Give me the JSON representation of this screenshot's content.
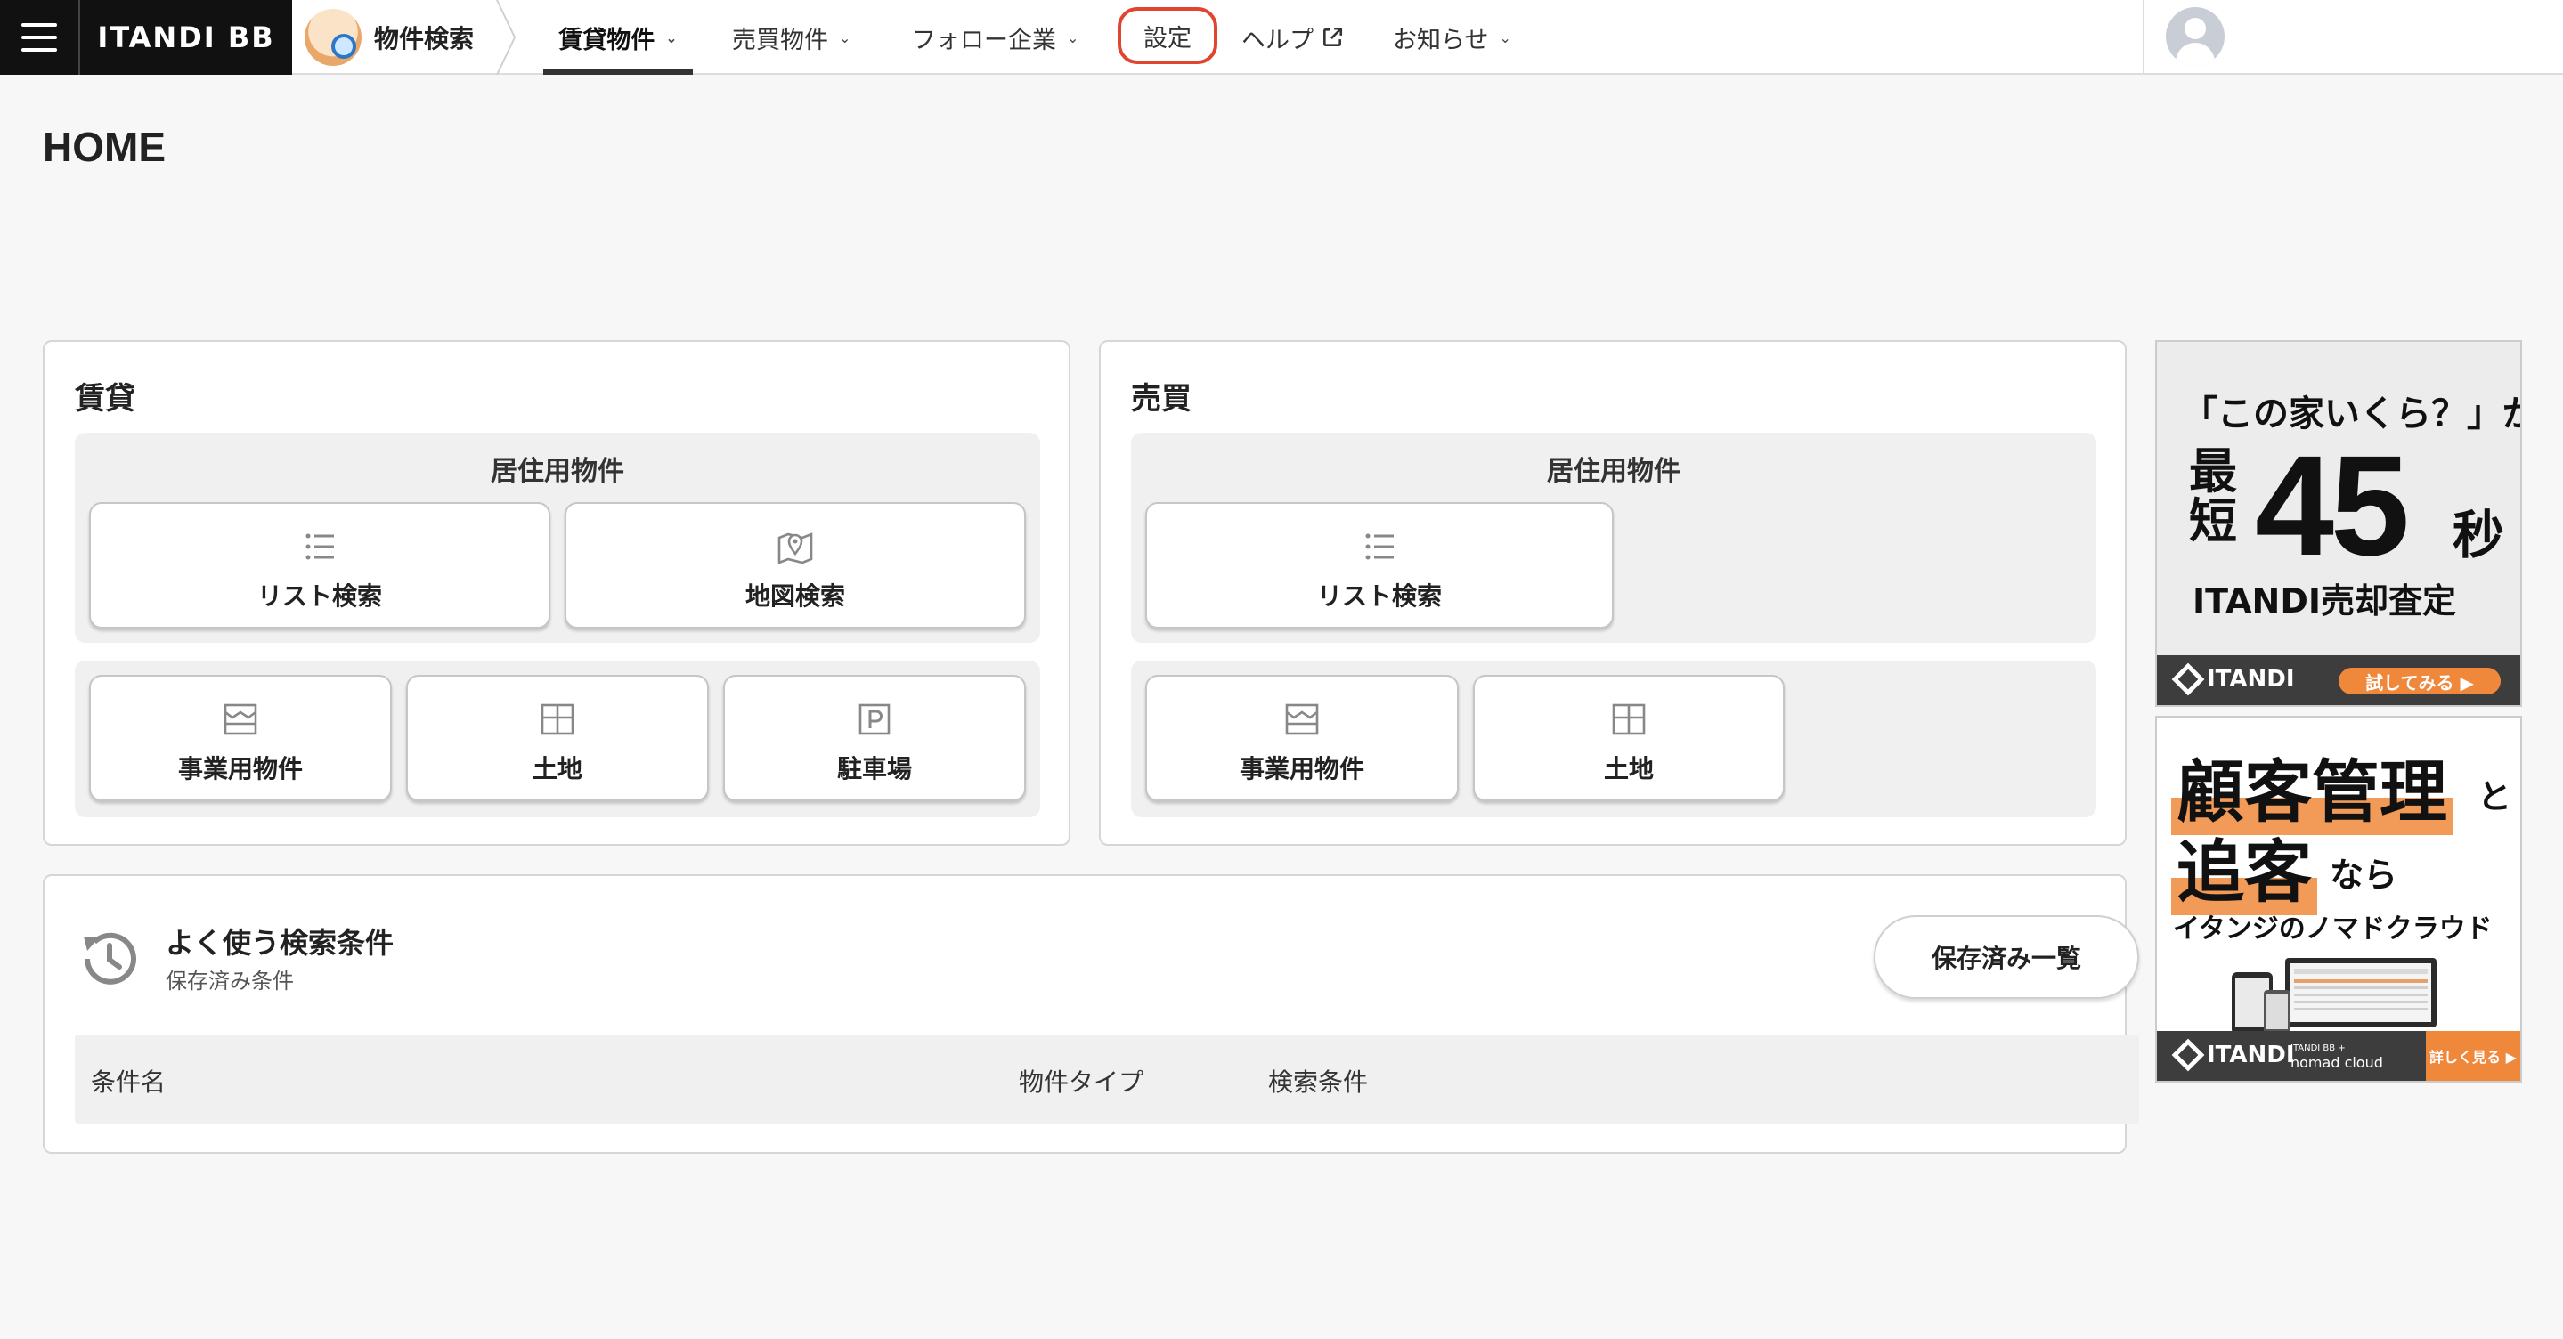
{
  "header": {
    "brand": "ITANDI BB",
    "app_tab": "物件検索",
    "nav": [
      {
        "label": "賃貸物件",
        "caret": "⌄"
      },
      {
        "label": "売買物件",
        "caret": "⌄"
      },
      {
        "label": "フォロー企業",
        "caret": "⌄"
      },
      {
        "label": "設定"
      },
      {
        "label": "ヘルプ"
      },
      {
        "label": "お知らせ",
        "caret": "⌄"
      }
    ],
    "accent_highlight": "#e0452f"
  },
  "page": {
    "title": "HOME"
  },
  "rental": {
    "title": "賃貸",
    "residential": {
      "title": "居住用物件",
      "list": "リスト検索",
      "map": "地図検索"
    },
    "other": {
      "business": "事業用物件",
      "land": "土地",
      "parking": "駐車場"
    }
  },
  "sales": {
    "title": "売買",
    "residential": {
      "title": "居住用物件",
      "list": "リスト検索"
    },
    "other": {
      "business": "事業用物件",
      "land": "土地"
    }
  },
  "saved_searches": {
    "title": "よく使う検索条件",
    "subtitle": "保存済み条件",
    "button": "保存済み一覧",
    "columns": [
      "条件名",
      "物件タイプ",
      "検索条件"
    ]
  },
  "ads": [
    {
      "line1": "「この家いくら？」が",
      "shortest": "最短",
      "number": "45",
      "unit": "秒",
      "line3": "ITANDI売却査定",
      "logo": "ITANDI",
      "cta": "試してみる ▶"
    },
    {
      "head1": "顧客管理",
      "to": "と",
      "head2": "追客",
      "nara": "なら",
      "line3": "イタンジのノマドクラウド",
      "logo": "ITANDI",
      "partner_small": "ITANDI BB +",
      "partner": "nomad cloud",
      "cta": "詳しく見る ▶"
    }
  ]
}
